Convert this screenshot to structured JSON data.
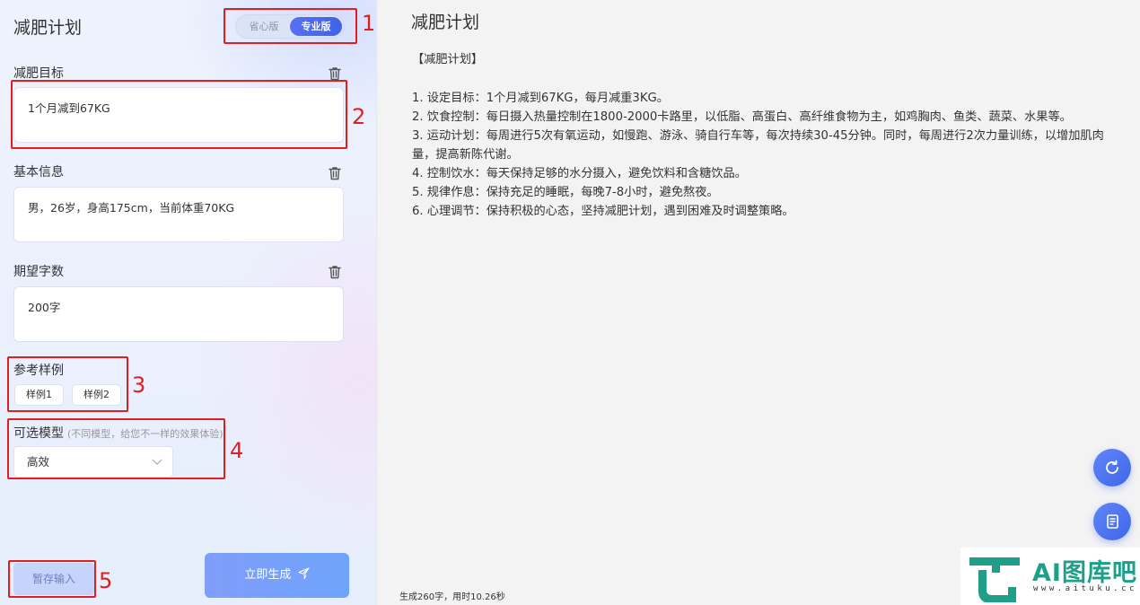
{
  "left_panel": {
    "title": "减肥计划",
    "mode_toggle": {
      "option_a": "省心版",
      "option_b": "专业版",
      "selected": "专业版"
    },
    "goal": {
      "label": "减肥目标",
      "value": "1个月减到67KG"
    },
    "basic_info": {
      "label": "基本信息",
      "value": "男，26岁，身高175cm，当前体重70KG"
    },
    "word_count": {
      "label": "期望字数",
      "value": "200字"
    },
    "samples": {
      "label": "参考样例",
      "items": [
        "样例1",
        "样例2"
      ]
    },
    "model": {
      "label": "可选模型",
      "hint": "(不同模型，给您不一样的效果体验)",
      "selected": "高效"
    },
    "save_button": "暂存输入",
    "generate_button": "立即生成"
  },
  "annotations": [
    "1",
    "2",
    "3",
    "4",
    "5"
  ],
  "output": {
    "title": "减肥计划",
    "heading": "【减肥计划】",
    "lines": [
      "1. 设定目标：1个月减到67KG，每月减重3KG。",
      "2. 饮食控制：每日摄入热量控制在1800-2000卡路里，以低脂、高蛋白、高纤维食物为主，如鸡胸肉、鱼类、蔬菜、水果等。",
      "3. 运动计划：每周进行5次有氧运动，如慢跑、游泳、骑自行车等，每次持续30-45分钟。同时，每周进行2次力量训练，以增加肌肉量，提高新陈代谢。",
      "4. 控制饮水：每天保持足够的水分摄入，避免饮料和含糖饮品。",
      "5. 规律作息：保持充足的睡眠，每晚7-8小时，避免熬夜。",
      "6. 心理调节：保持积极的心态，坚持减肥计划，遇到困难及时调整策略。"
    ],
    "stats": "生成260字，用时10.26秒"
  },
  "watermark": {
    "name": "AI图库吧",
    "url": "www.aituku.cc"
  },
  "colors": {
    "accent": "#3e63e8",
    "annotation": "#e02020",
    "brand": "#1f9f8a"
  }
}
